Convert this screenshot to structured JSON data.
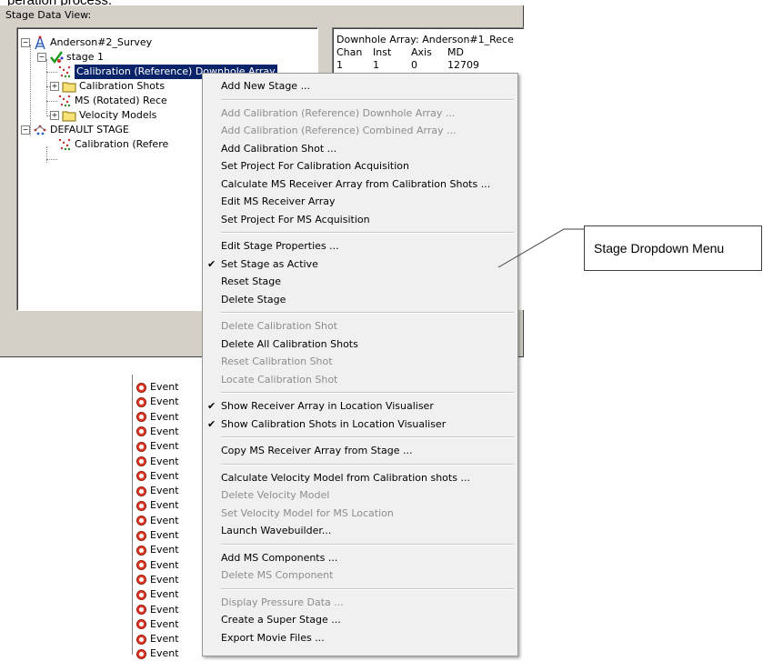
{
  "caption_top": "peration process.",
  "dialog": {
    "title": "Stage Data View:",
    "tree": {
      "survey": "Anderson#2_Survey",
      "stage1": "stage 1",
      "calib_downhole": "Calibration (Reference) Downhole Array",
      "calib_shots": "Calibration Shots",
      "ms_rotated": "MS (Rotated) Rece",
      "velocity_models": "Velocity Models",
      "default_stage": "DEFAULT STAGE",
      "default_calib": "Calibration (Refere"
    },
    "info": {
      "line1": "Downhole Array: Anderson#1_Rece",
      "headers": [
        "Chan",
        "Inst",
        "Axis",
        "MD"
      ],
      "row1": [
        "1",
        "1",
        "0",
        "12709"
      ]
    }
  },
  "events": {
    "label": "Event",
    "count": 19
  },
  "menu": {
    "items": [
      {
        "label": "Add New Stage ...",
        "enabled": true,
        "checked": false
      },
      {
        "sep": true
      },
      {
        "label": "Add Calibration (Reference) Downhole Array ...",
        "enabled": false,
        "checked": false
      },
      {
        "label": "Add Calibration (Reference) Combined Array ...",
        "enabled": false,
        "checked": false
      },
      {
        "label": "Add Calibration Shot ...",
        "enabled": true,
        "checked": false
      },
      {
        "label": "Set Project For Calibration Acquisition",
        "enabled": true,
        "checked": false
      },
      {
        "label": "Calculate MS Receiver Array from Calibration Shots ...",
        "enabled": true,
        "checked": false
      },
      {
        "label": "Edit MS Receiver Array",
        "enabled": true,
        "checked": false
      },
      {
        "label": "Set Project For MS Acquisition",
        "enabled": true,
        "checked": false
      },
      {
        "sep": true
      },
      {
        "label": "Edit Stage Properties ...",
        "enabled": true,
        "checked": false
      },
      {
        "label": "Set Stage as Active",
        "enabled": true,
        "checked": true
      },
      {
        "label": "Reset Stage",
        "enabled": true,
        "checked": false
      },
      {
        "label": "Delete Stage",
        "enabled": true,
        "checked": false
      },
      {
        "sep": true
      },
      {
        "label": "Delete Calibration Shot",
        "enabled": false,
        "checked": false
      },
      {
        "label": "Delete All Calibration Shots",
        "enabled": true,
        "checked": false
      },
      {
        "label": "Reset Calibration Shot",
        "enabled": false,
        "checked": false
      },
      {
        "label": "Locate Calibration Shot",
        "enabled": false,
        "checked": false
      },
      {
        "sep": true
      },
      {
        "label": "Show Receiver Array in Location Visualiser",
        "enabled": true,
        "checked": true
      },
      {
        "label": "Show Calibration Shots in Location Visualiser",
        "enabled": true,
        "checked": true
      },
      {
        "sep": true
      },
      {
        "label": "Copy MS Receiver Array from Stage ...",
        "enabled": true,
        "checked": false
      },
      {
        "sep": true
      },
      {
        "label": "Calculate Velocity Model from Calibration shots ...",
        "enabled": true,
        "checked": false
      },
      {
        "label": "Delete Velocity Model",
        "enabled": false,
        "checked": false
      },
      {
        "label": "Set Velocity Model for MS Location",
        "enabled": false,
        "checked": false
      },
      {
        "label": "Launch Wavebuilder...",
        "enabled": true,
        "checked": false
      },
      {
        "sep": true
      },
      {
        "label": "Add MS Components ...",
        "enabled": true,
        "checked": false
      },
      {
        "label": "Delete MS Component",
        "enabled": false,
        "checked": false
      },
      {
        "sep": true
      },
      {
        "label": "Display Pressure Data ...",
        "enabled": false,
        "checked": false
      },
      {
        "label": "Create a Super Stage ...",
        "enabled": true,
        "checked": false
      },
      {
        "label": "Export Movie Files ...",
        "enabled": true,
        "checked": false
      }
    ],
    "check_glyph": "✔"
  },
  "callout": {
    "label": "Stage Dropdown Menu"
  },
  "colors": {
    "selection": "#0a246a",
    "dialog_bg": "#d4d0c8",
    "menu_bg": "#f0f0f0",
    "event_icon": "#e23b2a"
  }
}
